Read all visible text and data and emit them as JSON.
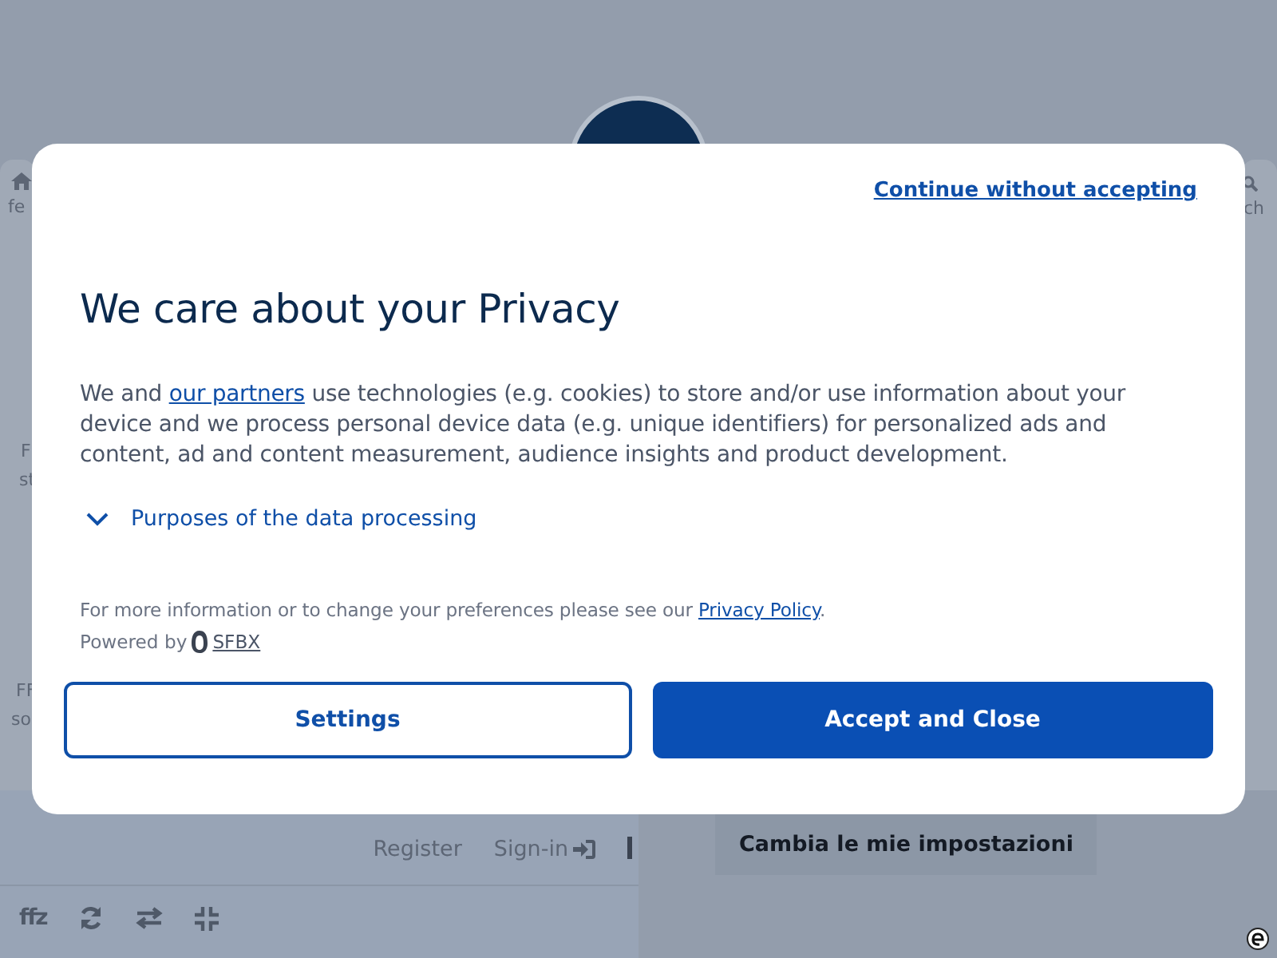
{
  "background": {
    "left_fragments": [
      {
        "text": "fe",
        "kind": "home"
      },
      {
        "text": "F",
        "kind": "plain"
      },
      {
        "text": "st",
        "kind": "plain"
      },
      {
        "text": "FF",
        "kind": "plain"
      },
      {
        "text": "so",
        "kind": "plain"
      }
    ],
    "right_fragment": "ch",
    "links": [
      {
        "label": "Register",
        "kind": "plain"
      },
      {
        "label": "Sign-in",
        "kind": "signin"
      }
    ],
    "settings_button": "Cambia le mie impostazioni",
    "toolbar": [
      {
        "kind": "text",
        "label": "ffz"
      },
      {
        "kind": "refresh"
      },
      {
        "kind": "swap"
      },
      {
        "kind": "compress"
      }
    ]
  },
  "modal": {
    "continue_link": "Continue without accepting",
    "title": "We care about your Privacy",
    "body": {
      "before": "We and",
      "link": "our partners",
      "after": "use technologies (e.g. cookies) to store and/or use information about your device and we process personal device data (e.g. unique identifiers) for personalized ads and content, ad and content measurement, audience insights and product development."
    },
    "purposes": {
      "label": "Purposes of the data processing",
      "expanded": false
    },
    "info": {
      "text": "For more information or to change your preferences please see our",
      "link": "Privacy Policy",
      "after": "."
    },
    "powered_by": {
      "text": "Powered by",
      "link": "SFBX"
    },
    "buttons": [
      {
        "label": "Settings",
        "kind": "secondary"
      },
      {
        "label": "Accept and Close",
        "kind": "primary"
      }
    ]
  }
}
